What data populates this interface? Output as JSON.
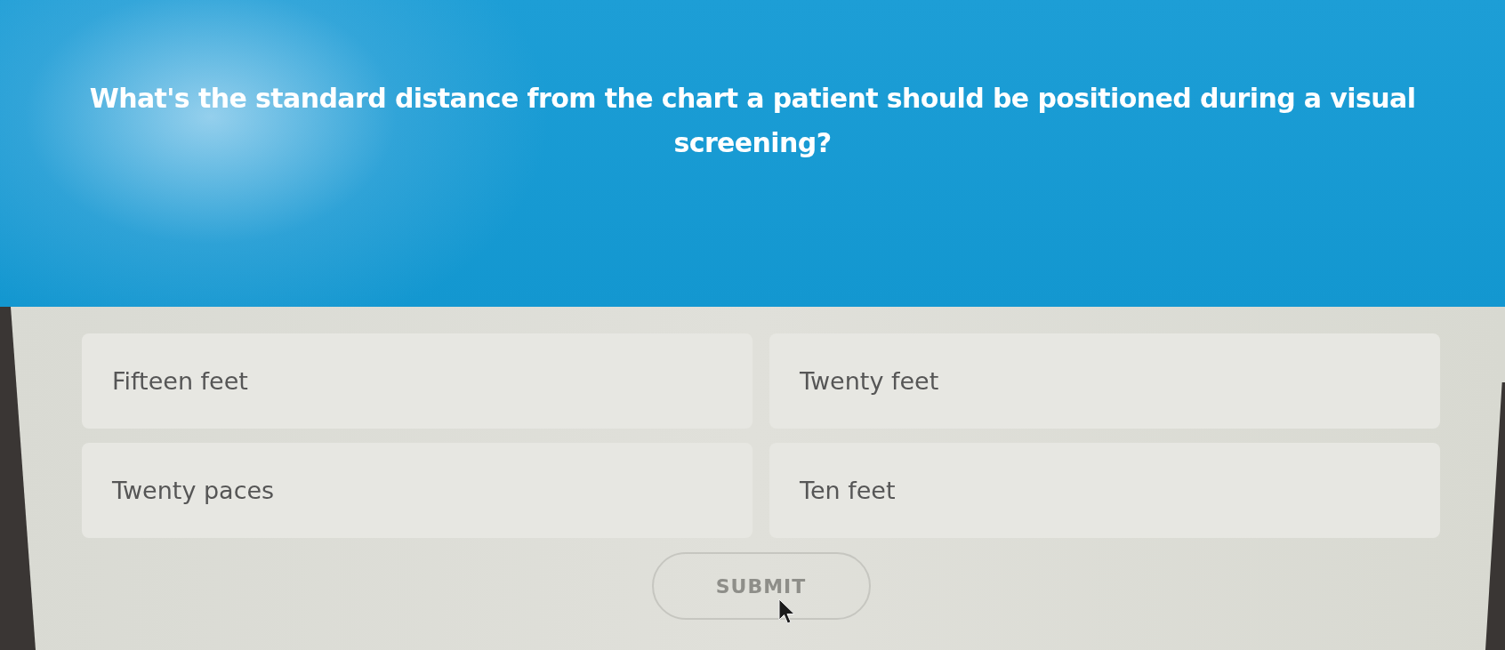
{
  "question": "What's the standard distance from the chart a patient should be positioned during a visual screening?",
  "options": [
    {
      "label": "Fifteen feet",
      "selected": false
    },
    {
      "label": "Twenty feet",
      "selected": false
    },
    {
      "label": "Twenty paces",
      "selected": false
    },
    {
      "label": "Ten feet",
      "selected": false
    }
  ],
  "submit": {
    "label": "SUBMIT",
    "disabled": true
  }
}
